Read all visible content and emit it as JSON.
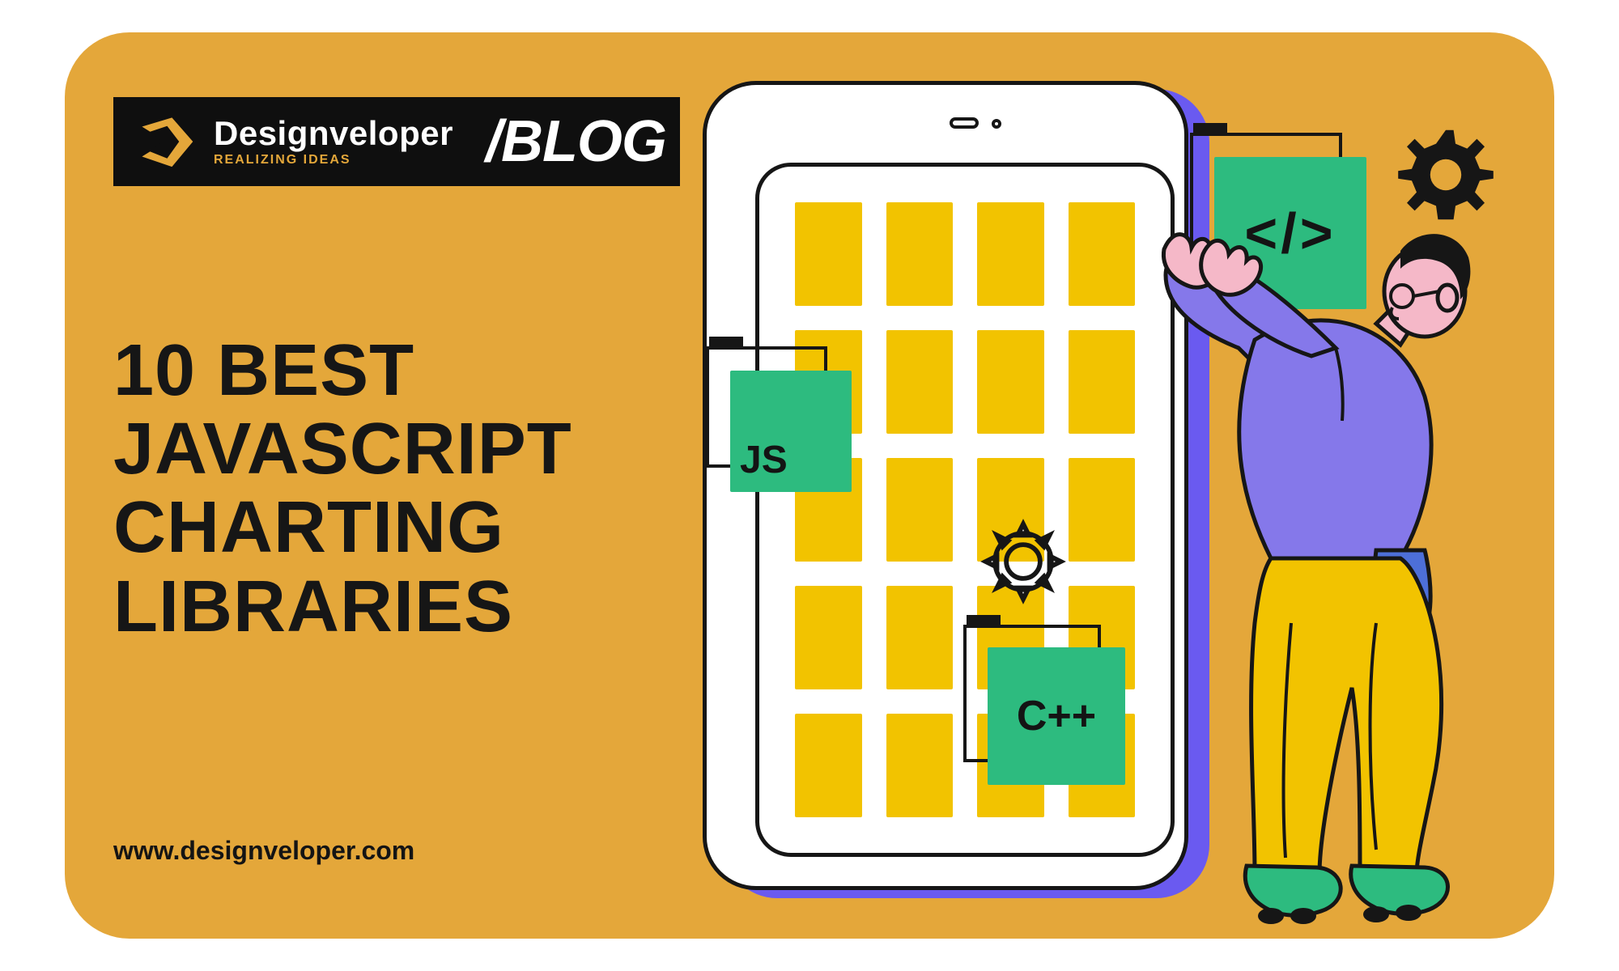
{
  "brand": {
    "name": "Designveloper",
    "tagline": "REALIZING IDEAS",
    "blog_label": "/BLOG"
  },
  "headline": "10 BEST JAVASCRIPT CHARTING LIBRARIES",
  "url": "www.designveloper.com",
  "tiles": {
    "js": "JS",
    "cpp": "C++",
    "code": "</>"
  },
  "colors": {
    "bg": "#e4a73a",
    "tile": "#f2c300",
    "green": "#2dbb7f",
    "purple": "#8578ea",
    "dark": "#161616"
  }
}
